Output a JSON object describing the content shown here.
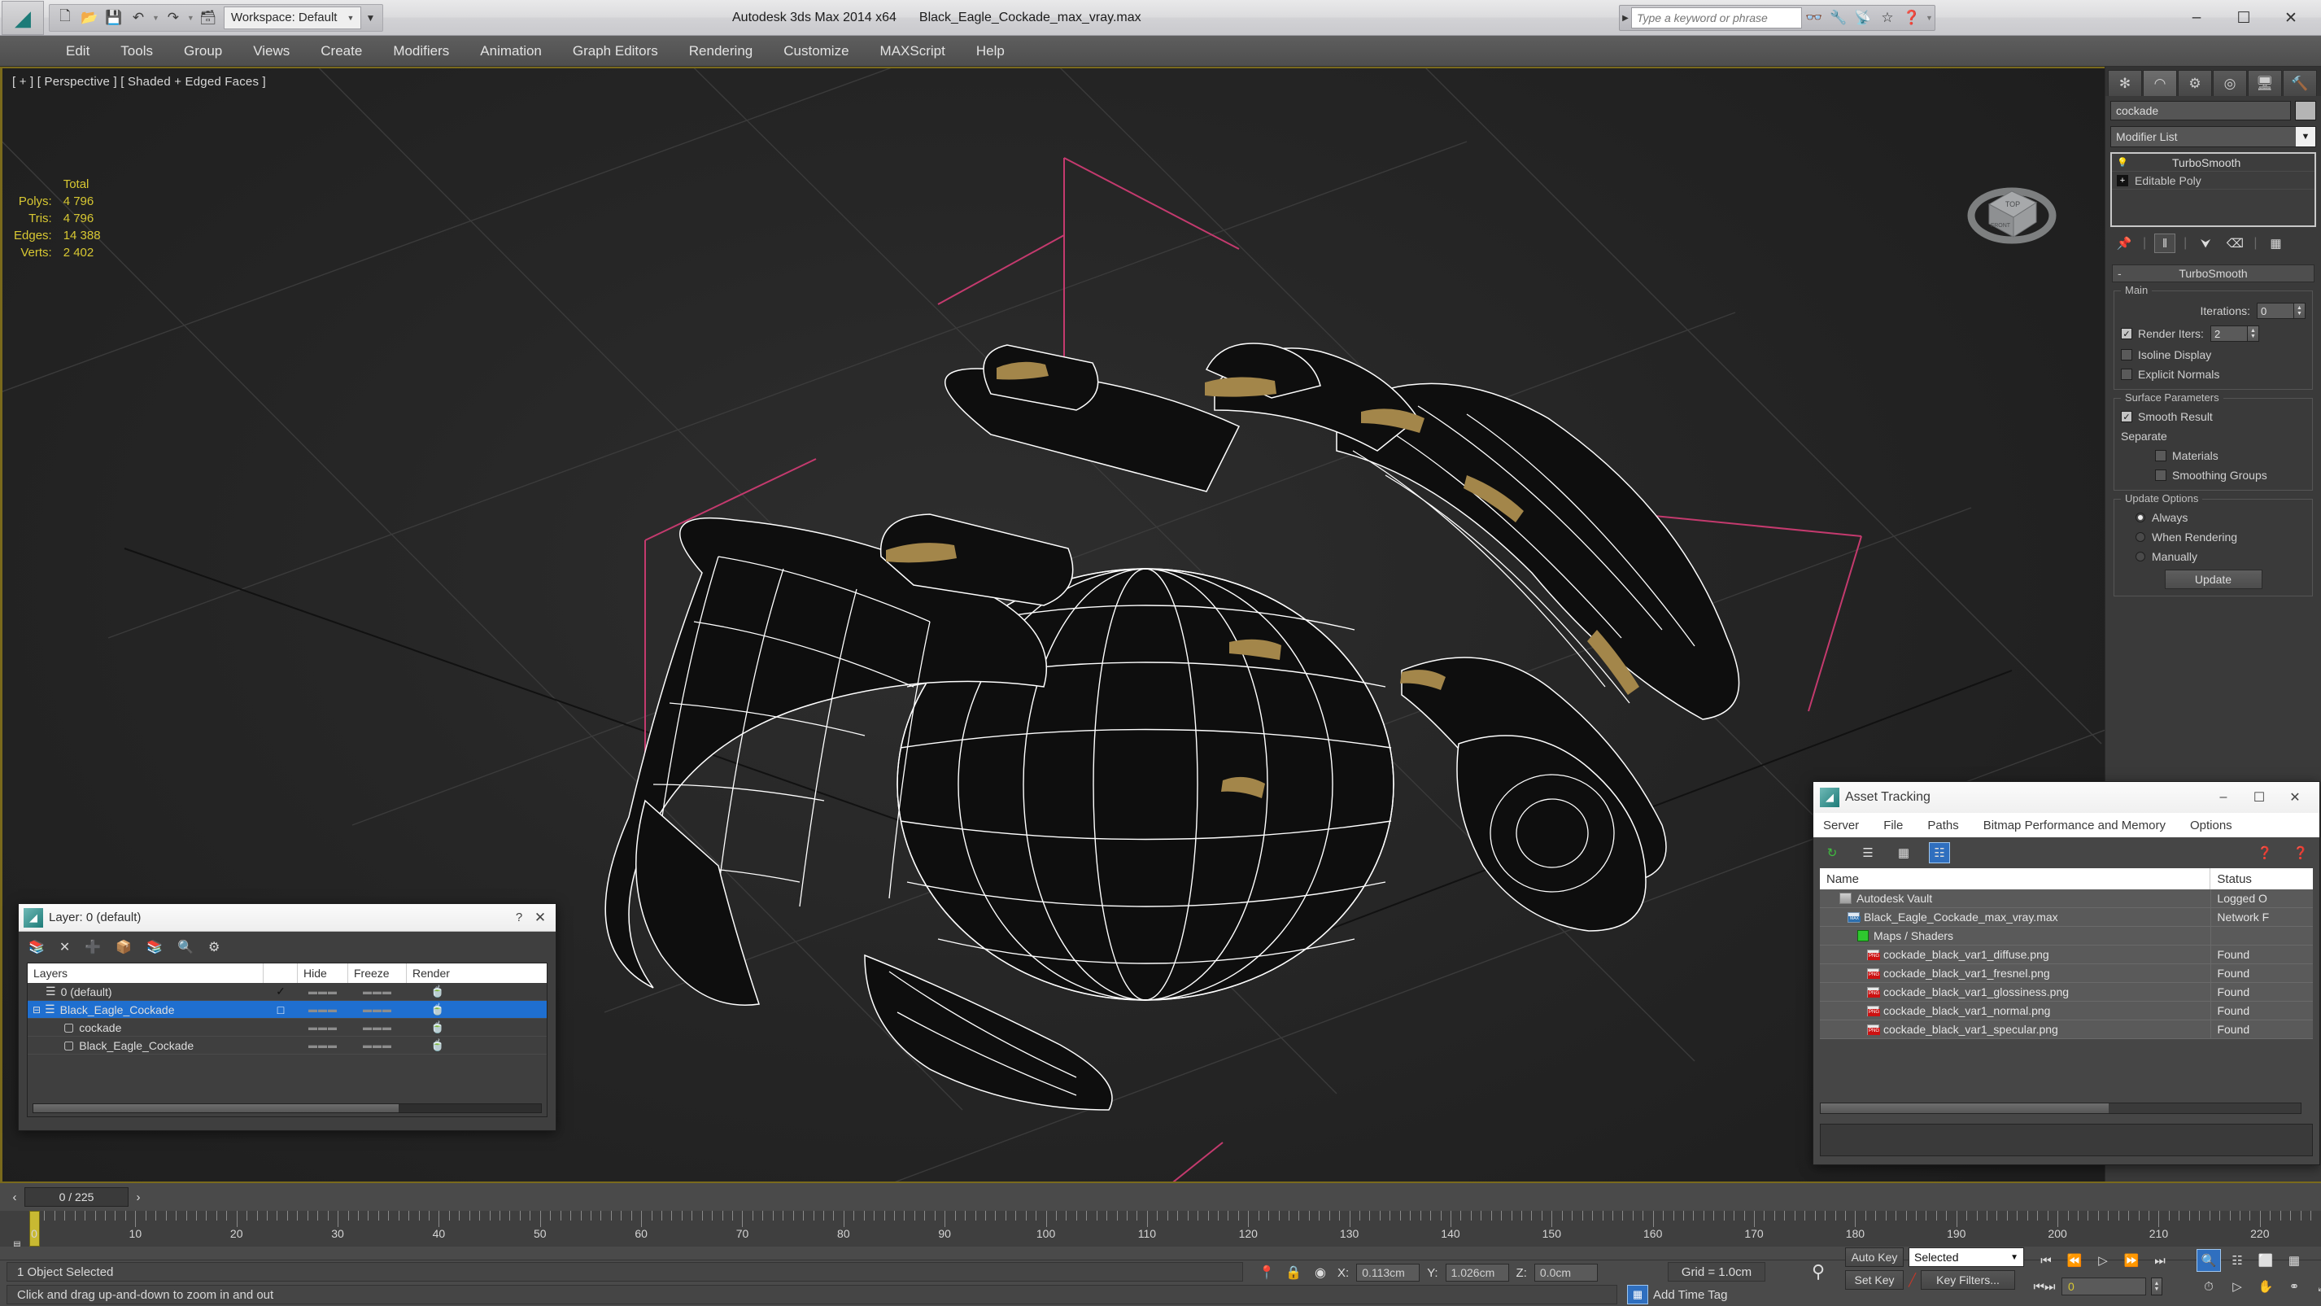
{
  "titlebar": {
    "app_logo_icon": "3dsmax-logo-icon",
    "quick_access": [
      {
        "label": "new-file-icon",
        "glyph": "⬜"
      },
      {
        "label": "open-file-icon",
        "glyph": "📂"
      },
      {
        "label": "save-file-icon",
        "glyph": "💾"
      },
      {
        "label": "undo-icon",
        "glyph": "↶"
      },
      {
        "label": "redo-icon",
        "glyph": "↷"
      },
      {
        "label": "set-project-folder-icon",
        "glyph": "🗂"
      }
    ],
    "workspace_label": "Workspace: Default",
    "app_title": "Autodesk 3ds Max  2014 x64",
    "file_name": "Black_Eagle_Cockade_max_vray.max",
    "search_placeholder": "Type a keyword or phrase",
    "search_value": "",
    "search_icons": [
      "binoculars-icon",
      "wrench-icon",
      "satellite-icon",
      "star-icon",
      "help-icon"
    ],
    "window_minimize": "–",
    "window_maximize": "☐",
    "window_close": "✕"
  },
  "menubar": {
    "items": [
      "Edit",
      "Tools",
      "Group",
      "Views",
      "Create",
      "Modifiers",
      "Animation",
      "Graph Editors",
      "Rendering",
      "Customize",
      "MAXScript",
      "Help"
    ]
  },
  "viewport": {
    "label": "[ + ] [ Perspective ] [ Shaded + Edged Faces ]",
    "stats": {
      "header": "Total",
      "rows": [
        {
          "name": "Polys:",
          "value": "4 796"
        },
        {
          "name": "Tris:",
          "value": "4 796"
        },
        {
          "name": "Edges:",
          "value": "14 388"
        },
        {
          "name": "Verts:",
          "value": "2 402"
        }
      ]
    },
    "viewcube_top": "TOP",
    "viewcube_front": "FRONT",
    "colors": {
      "background": "#262626",
      "wireframe": "#ffffff",
      "grid": "#3a3a3a",
      "gizmo_pink": "#c43a6e",
      "gizmo_red": "#d11b1b",
      "gold_accent": "#a3864a"
    }
  },
  "command_panel": {
    "tabs": [
      {
        "name": "create-tab",
        "glyph": "✳"
      },
      {
        "name": "modify-tab",
        "glyph": "◠"
      },
      {
        "name": "hierarchy-tab",
        "glyph": "⛓"
      },
      {
        "name": "motion-tab",
        "glyph": "◎"
      },
      {
        "name": "display-tab",
        "glyph": "🖥"
      },
      {
        "name": "utilities-tab",
        "glyph": "🔨"
      }
    ],
    "active_tab_index": 1,
    "object_name": "cockade",
    "modifier_list_label": "Modifier List",
    "stack": [
      {
        "label": "TurboSmooth",
        "icon": "lightbulb-icon",
        "selected": true
      },
      {
        "label": "Editable Poly",
        "icon": "plus-box-icon",
        "selected": false
      }
    ],
    "stack_tools": [
      "pin-stack-icon",
      "show-end-result-icon",
      "make-unique-icon",
      "remove-modifier-icon",
      "configure-sets-icon"
    ],
    "rollout": {
      "title": "TurboSmooth",
      "main_group": "Main",
      "iterations_label": "Iterations:",
      "iterations_value": "0",
      "render_iters_label": "Render Iters:",
      "render_iters_value": "2",
      "render_iters_checked": true,
      "isoline_display_label": "Isoline Display",
      "isoline_display_checked": false,
      "explicit_normals_label": "Explicit Normals",
      "explicit_normals_checked": false,
      "surface_group": "Surface Parameters",
      "smooth_result_label": "Smooth Result",
      "smooth_result_checked": true,
      "separate_label": "Separate",
      "materials_label": "Materials",
      "materials_checked": false,
      "smoothing_groups_label": "Smoothing Groups",
      "smoothing_groups_checked": false,
      "update_group": "Update Options",
      "update_always": "Always",
      "update_when_rendering": "When Rendering",
      "update_manually": "Manually",
      "update_selected": "Always",
      "update_button": "Update"
    }
  },
  "layer_dialog": {
    "title": "Layer: 0 (default)",
    "help_glyph": "?",
    "close_glyph": "✕",
    "toolbar": [
      "new-layer-icon",
      "delete-layer-icon",
      "add-layer-icon",
      "select-objects-in-layer-icon",
      "select-highlighted-layer-icon",
      "highlight-selected-objects-layer-icon",
      "layer-properties-icon"
    ],
    "columns": [
      "Layers",
      "",
      "Hide",
      "Freeze",
      "Render"
    ],
    "rows": [
      {
        "name": "0 (default)",
        "indent": 1,
        "icon": "layer-icon",
        "current": "✓",
        "hide": "",
        "freeze": "",
        "render": "teapot-icon",
        "selected": false,
        "expander": ""
      },
      {
        "name": "Black_Eagle_Cockade",
        "indent": 0,
        "icon": "layer-icon",
        "current": "□",
        "hide": "",
        "freeze": "",
        "render": "teapot-icon",
        "selected": true,
        "expander": "⊟"
      },
      {
        "name": "cockade",
        "indent": 2,
        "icon": "object-icon",
        "current": "",
        "hide": "",
        "freeze": "",
        "render": "teapot-icon",
        "selected": false,
        "expander": ""
      },
      {
        "name": "Black_Eagle_Cockade",
        "indent": 2,
        "icon": "object-icon",
        "current": "",
        "hide": "",
        "freeze": "",
        "render": "teapot-icon",
        "selected": false,
        "expander": ""
      }
    ]
  },
  "asset_tracking": {
    "title": "Asset Tracking",
    "window_minimize": "–",
    "window_maximize": "☐",
    "window_close": "✕",
    "menus": [
      "Server",
      "File",
      "Paths",
      "Bitmap Performance and Memory",
      "Options"
    ],
    "toolbar": [
      "refresh-icon",
      "list-view-icon",
      "detail-view-icon",
      "grid-view-icon"
    ],
    "toolbar_right": [
      "vault-help-icon",
      "asset-help-icon"
    ],
    "columns": [
      "Name",
      "Status"
    ],
    "rows": [
      {
        "name": "Autodesk Vault",
        "status": "Logged O",
        "indent": 1,
        "icon": "vault-icon"
      },
      {
        "name": "Black_Eagle_Cockade_max_vray.max",
        "status": "Network F",
        "indent": 2,
        "icon": "max-file-icon"
      },
      {
        "name": "Maps / Shaders",
        "status": "",
        "indent": 3,
        "icon": "maps-shaders-icon"
      },
      {
        "name": "cockade_black_var1_diffuse.png",
        "status": "Found",
        "indent": 4,
        "icon": "png-icon"
      },
      {
        "name": "cockade_black_var1_fresnel.png",
        "status": "Found",
        "indent": 4,
        "icon": "png-icon"
      },
      {
        "name": "cockade_black_var1_glossiness.png",
        "status": "Found",
        "indent": 4,
        "icon": "png-icon"
      },
      {
        "name": "cockade_black_var1_normal.png",
        "status": "Found",
        "indent": 4,
        "icon": "png-icon"
      },
      {
        "name": "cockade_black_var1_specular.png",
        "status": "Found",
        "indent": 4,
        "icon": "png-icon"
      }
    ]
  },
  "timeline": {
    "frame_readout": "0 / 225",
    "prev_glyph": "‹",
    "next_glyph": "›",
    "current_frame": 0,
    "range_start": 0,
    "range_end": 225,
    "tick_labels": [
      0,
      10,
      20,
      30,
      40,
      50,
      60,
      70,
      80,
      90,
      100,
      110,
      120,
      130,
      140,
      150,
      160,
      170,
      180,
      190,
      200,
      210,
      220
    ],
    "key_mode_icon": "open-mini-curve-editor-icon"
  },
  "statusbar": {
    "selection_text": "1 Object Selected",
    "prompt_text": "Click and drag up-and-down to zoom in and out",
    "isolate_icon": "isolate-selection-icon",
    "lock_icon": "selection-lock-icon",
    "transform_icon": "transform-type-in-icon",
    "x_label": "X:",
    "x_value": "0.113cm",
    "y_label": "Y:",
    "y_value": "1.026cm",
    "z_label": "Z:",
    "z_value": "0.0cm",
    "grid_text": "Grid = 1.0cm",
    "add_time_tag": "Add Time Tag",
    "key_toggle_icon": "key-mode-toggle-icon"
  },
  "animation_controls": {
    "auto_key": "Auto Key",
    "set_key": "Set Key",
    "filter_value": "Selected",
    "key_filters": "Key Filters...",
    "frame_value": "0",
    "playback": [
      "go-to-start-icon",
      "previous-frame-icon",
      "play-animation-icon",
      "next-frame-icon",
      "go-to-end-icon"
    ],
    "nav_row1": [
      "zoom-icon",
      "zoom-all-icon",
      "zoom-extents-icon",
      "zoom-extents-all-icon"
    ],
    "nav_row2": [
      "time-configuration-icon",
      "field-of-view-icon",
      "pan-view-icon",
      "orbit-icon",
      "maximize-viewport-toggle-icon"
    ],
    "active_nav": "zoom-icon"
  }
}
